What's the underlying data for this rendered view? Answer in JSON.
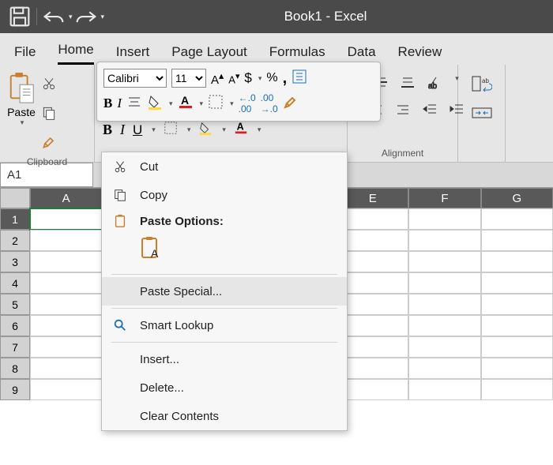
{
  "window": {
    "title": "Book1  -  Excel"
  },
  "tabs": {
    "file": "File",
    "home": "Home",
    "insert": "Insert",
    "pagelayout": "Page Layout",
    "formulas": "Formulas",
    "data": "Data",
    "review": "Review"
  },
  "ribbon": {
    "clipboard_label": "Clipboard",
    "paste_label": "Paste",
    "alignment_label": "Alignment",
    "font_name": "Calibri",
    "font_size": "11"
  },
  "namebox": {
    "value": "A1"
  },
  "columns": [
    "A",
    "E",
    "F",
    "G"
  ],
  "rows": [
    "1",
    "2",
    "3",
    "4",
    "5",
    "6",
    "7",
    "8",
    "9"
  ],
  "context": {
    "cut": "Cut",
    "copy": "Copy",
    "paste_options": "Paste Options:",
    "paste_special": "Paste Special...",
    "smart_lookup": "Smart Lookup",
    "insert": "Insert...",
    "delete": "Delete...",
    "clear_contents": "Clear Contents"
  }
}
